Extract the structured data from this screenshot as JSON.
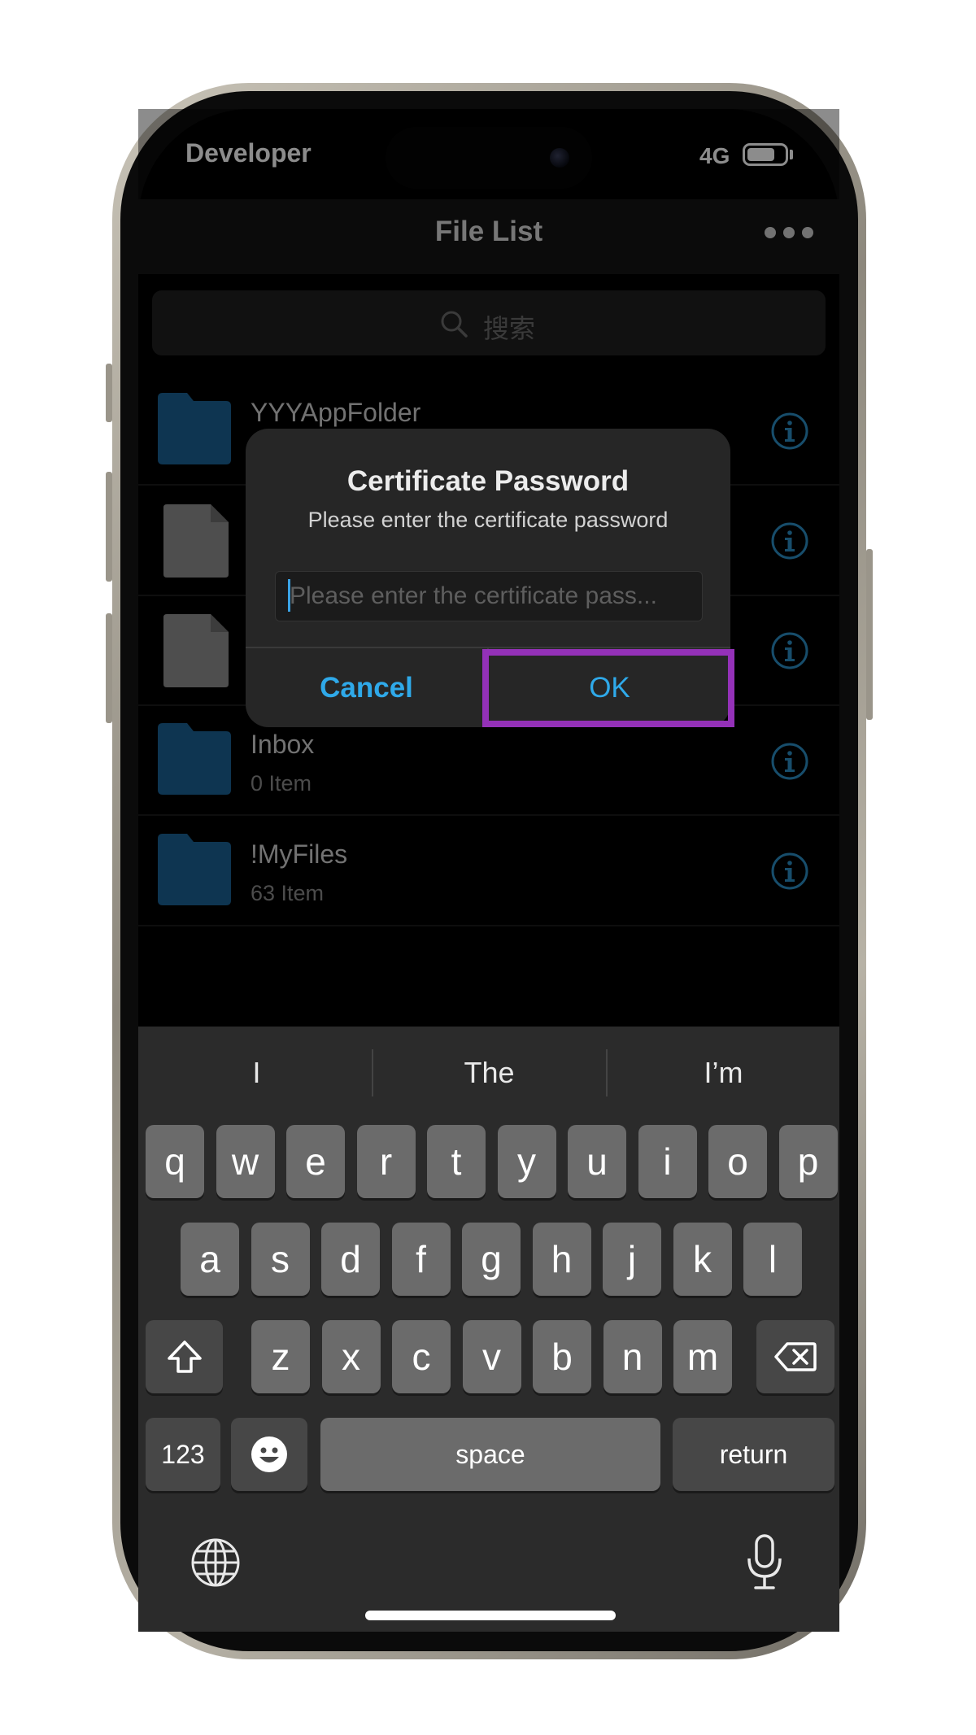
{
  "status_bar": {
    "carrier": "Developer",
    "network": "4G",
    "battery_level": 0.75
  },
  "nav": {
    "title": "File List",
    "more_icon": "ellipsis-icon"
  },
  "search": {
    "placeholder": "搜索",
    "icon": "search-icon"
  },
  "files": [
    {
      "name": "YYYAppFolder",
      "subtitle": "",
      "type": "folder"
    },
    {
      "name": "",
      "subtitle": "",
      "type": "document"
    },
    {
      "name": "",
      "subtitle": "",
      "type": "document"
    },
    {
      "name": "Inbox",
      "subtitle": "0 Item",
      "type": "folder"
    },
    {
      "name": "!MyFiles",
      "subtitle": "63 Item",
      "type": "folder"
    }
  ],
  "dialog": {
    "title": "Certificate Password",
    "message": "Please enter the certificate password",
    "input_placeholder": "Please enter the certificate pass...",
    "input_value": "",
    "cancel_label": "Cancel",
    "ok_label": "OK"
  },
  "keyboard": {
    "suggestions": [
      "I",
      "The",
      "I’m"
    ],
    "row1": [
      "q",
      "w",
      "e",
      "r",
      "t",
      "y",
      "u",
      "i",
      "o",
      "p"
    ],
    "row2": [
      "a",
      "s",
      "d",
      "f",
      "g",
      "h",
      "j",
      "k",
      "l"
    ],
    "row3": [
      "z",
      "x",
      "c",
      "v",
      "b",
      "n",
      "m"
    ],
    "numbers_label": "123",
    "space_label": "space",
    "return_label": "return"
  },
  "colors": {
    "accent": "#2fa9e9",
    "folder": "#1a6294",
    "highlight": "#9431b8"
  }
}
